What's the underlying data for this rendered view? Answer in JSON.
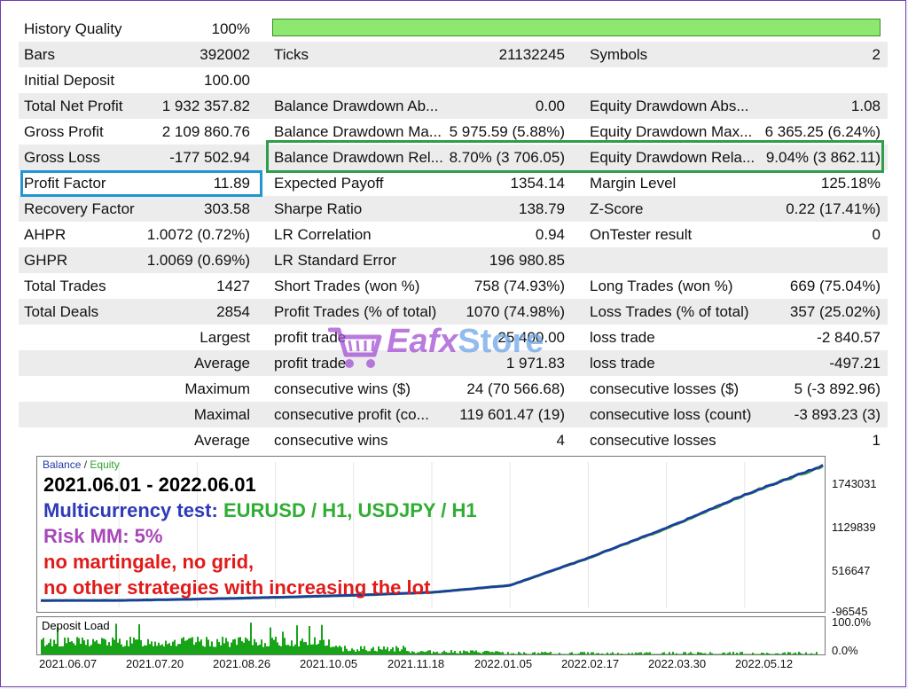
{
  "report": {
    "history_quality": {
      "label": "History Quality",
      "value": "100%"
    },
    "rows": [
      {
        "c1": "Bars",
        "c2": "392002",
        "c3": "Ticks",
        "c4": "21132245",
        "c5": "Symbols",
        "c6": "2"
      },
      {
        "c1": "Initial Deposit",
        "c2": "100.00",
        "c3": "",
        "c4": "",
        "c5": "",
        "c6": ""
      },
      {
        "c1": "Total Net Profit",
        "c2": "1 932 357.82",
        "c3": "Balance Drawdown Ab...",
        "c4": "0.00",
        "c5": "Equity Drawdown Abs...",
        "c6": "1.08"
      },
      {
        "c1": "Gross Profit",
        "c2": "2 109 860.76",
        "c3": "Balance Drawdown Ma...",
        "c4": "5 975.59 (5.88%)",
        "c5": "Equity Drawdown Max...",
        "c6": "6 365.25 (6.24%)"
      },
      {
        "c1": "Gross Loss",
        "c2": "-177 502.94",
        "c3": "Balance Drawdown Rel...",
        "c4": "8.70% (3 706.05)",
        "c5": "Equity Drawdown Rela...",
        "c6": "9.04% (3 862.11)"
      },
      {
        "c1": "Profit Factor",
        "c2": "11.89",
        "c3": "Expected Payoff",
        "c4": "1354.14",
        "c5": "Margin Level",
        "c6": "125.18%"
      },
      {
        "c1": "Recovery Factor",
        "c2": "303.58",
        "c3": "Sharpe Ratio",
        "c4": "138.79",
        "c5": "Z-Score",
        "c6": "0.22 (17.41%)"
      },
      {
        "c1": "AHPR",
        "c2": "1.0072 (0.72%)",
        "c3": "LR Correlation",
        "c4": "0.94",
        "c5": "OnTester result",
        "c6": "0"
      },
      {
        "c1": "GHPR",
        "c2": "1.0069 (0.69%)",
        "c3": "LR Standard Error",
        "c4": "196 980.85",
        "c5": "",
        "c6": ""
      },
      {
        "c1": "Total Trades",
        "c2": "1427",
        "c3": "Short Trades (won %)",
        "c4": "758 (74.93%)",
        "c5": "Long Trades (won %)",
        "c6": "669 (75.04%)"
      },
      {
        "c1": "Total Deals",
        "c2": "2854",
        "c3": "Profit Trades (% of total)",
        "c4": "1070 (74.98%)",
        "c5": "Loss Trades (% of total)",
        "c6": "357 (25.02%)"
      }
    ],
    "trade_rows": [
      {
        "r1": "Largest",
        "c3": "profit trade",
        "c4": "25 400.00",
        "c5": "loss trade",
        "c6": "-2 840.57"
      },
      {
        "r1": "Average",
        "c3": "profit trade",
        "c4": "1 971.83",
        "c5": "loss trade",
        "c6": "-497.21"
      },
      {
        "r1": "Maximum",
        "c3": "consecutive wins ($)",
        "c4": "24 (70 566.68)",
        "c5": "consecutive losses ($)",
        "c6": "5 (-3 892.96)"
      },
      {
        "r1": "Maximal",
        "c3": "consecutive profit (co...",
        "c4": "119 601.47 (19)",
        "c5": "consecutive loss (count)",
        "c6": "-3 893.23 (3)"
      },
      {
        "r1": "Average",
        "c3": "consecutive wins",
        "c4": "4",
        "c5": "consecutive losses",
        "c6": "1"
      }
    ]
  },
  "watermark": {
    "part1": "Eafx",
    "part2": "Store"
  },
  "chart": {
    "legend": {
      "balance": "Balance",
      "sep": "/",
      "equity": "Equity"
    },
    "annotations": {
      "date": "2021.06.01 - 2022.06.01",
      "multi_label": "Multicurrency test:",
      "multi_value": "EURUSD / H1, USDJPY / H1",
      "risk": "Risk MM: 5%",
      "no_martingale": "no martingale, no grid,",
      "no_other": "no other strategies with increasing the lot"
    },
    "colors": {
      "balance": "#1f3aa8",
      "equity": "#2fa12f",
      "deposit": "#18a418"
    },
    "deposit_label": "Deposit Load"
  },
  "chart_data": [
    {
      "type": "line",
      "x": [
        "2021.06.01",
        "2021.06.07",
        "2021.07.20",
        "2021.08.26",
        "2021.10.05",
        "2021.11.18",
        "2022.01.05",
        "2022.02.17",
        "2022.03.30",
        "2022.05.12",
        "2022.06.01"
      ],
      "series": [
        {
          "name": "Balance",
          "values": [
            100,
            2000,
            20000,
            45000,
            75000,
            115000,
            215000,
            600000,
            1020000,
            1490000,
            1900000
          ]
        },
        {
          "name": "Equity",
          "values": [
            99,
            1990,
            19900,
            44900,
            74900,
            114900,
            214000,
            598000,
            1018000,
            1487000,
            1895000
          ]
        }
      ],
      "yticks": [
        "1743031",
        "1129839",
        "516647",
        "-96545"
      ],
      "ylim": [
        -96545,
        1950000
      ]
    },
    {
      "type": "bar",
      "title": "Deposit Load",
      "yticks": [
        "100.0%",
        "0.0%"
      ],
      "ylim": [
        0,
        100
      ],
      "xticks": [
        "2021.06.07",
        "2021.07.20",
        "2021.08.26",
        "2021.10.05",
        "2021.11.18",
        "2022.01.05",
        "2022.02.17",
        "2022.03.30",
        "2022.05.12"
      ]
    }
  ]
}
